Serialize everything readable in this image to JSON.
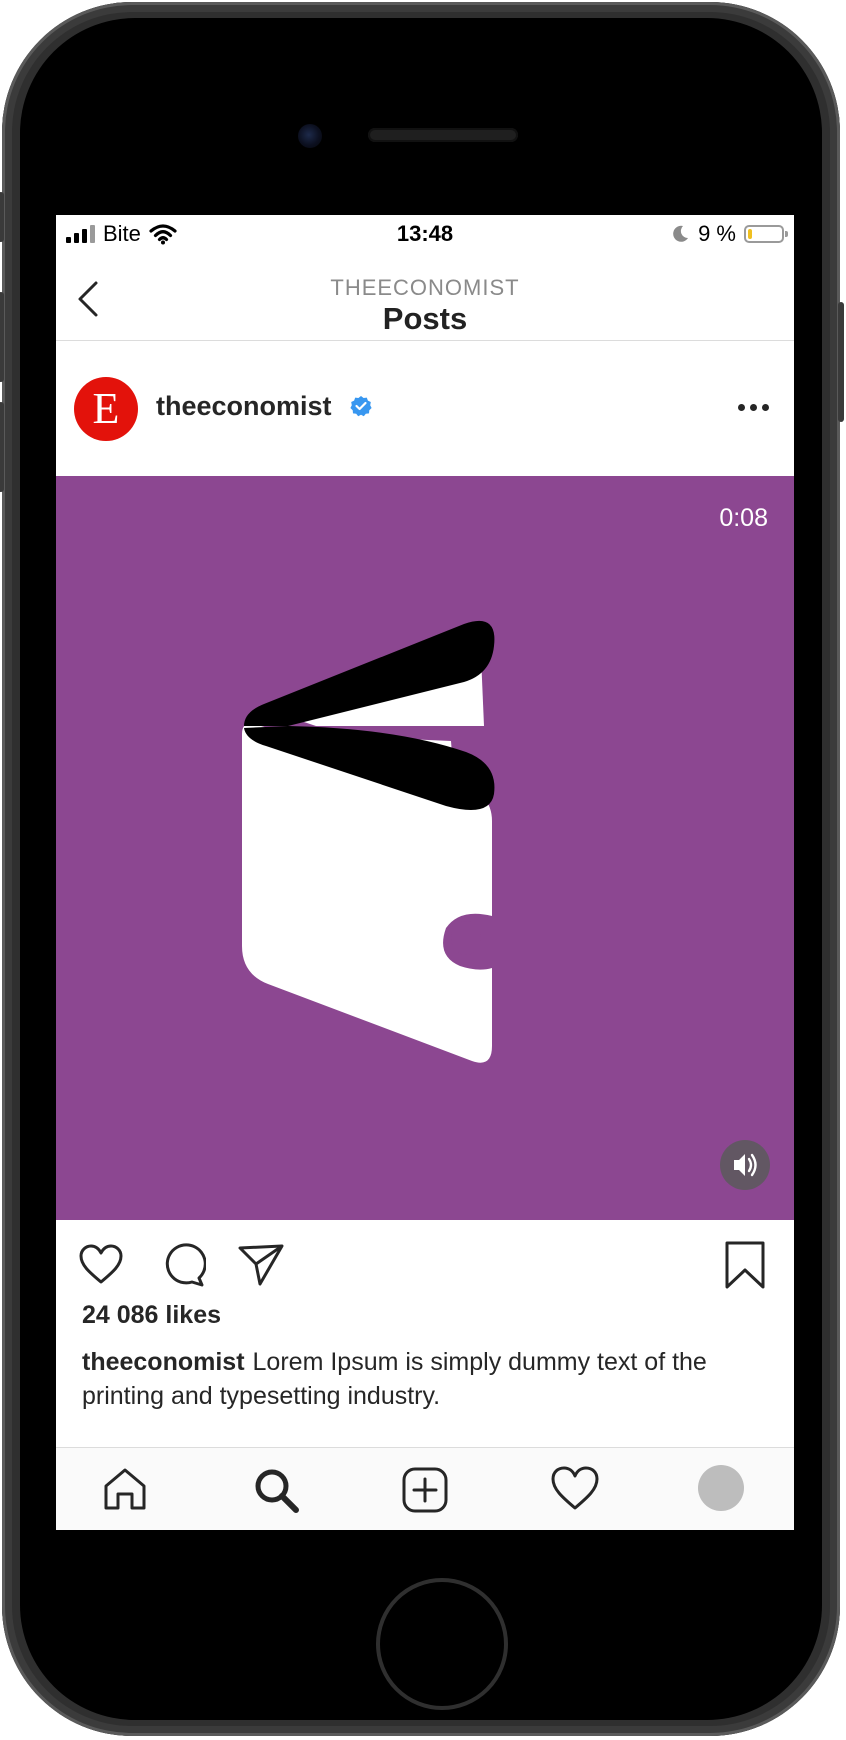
{
  "status_bar": {
    "carrier": "Bite",
    "time": "13:48",
    "battery": "9 %"
  },
  "nav": {
    "subtitle": "THEECONOMIST",
    "title": "Posts"
  },
  "post": {
    "avatar_letter": "E",
    "username": "theeconomist",
    "video_time": "0:08",
    "likes": "24 086 likes",
    "caption_user": "theeconomist",
    "caption_text": "Lorem Ipsum is simply dummy text of the printing and typesetting industry."
  },
  "icons": [
    "back-icon",
    "verified-icon",
    "more-icon",
    "volume-icon",
    "heart-icon",
    "comment-icon",
    "share-icon",
    "bookmark-icon",
    "home-icon",
    "search-icon",
    "add-icon",
    "activity-icon",
    "profile-icon",
    "moon-icon",
    "wifi-icon",
    "battery-icon"
  ],
  "colors": {
    "media_bg": "#8c4791",
    "brand_red": "#e3120b",
    "verified_blue": "#3897f0"
  }
}
